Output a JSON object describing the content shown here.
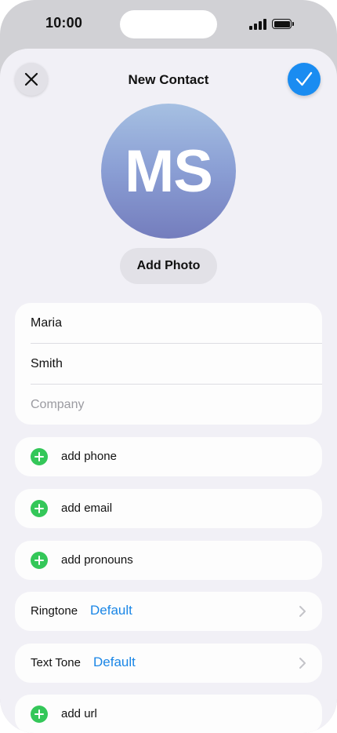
{
  "status": {
    "time": "10:00"
  },
  "nav": {
    "title": "New Contact",
    "cancel_icon": "close-icon",
    "done_icon": "checkmark-icon"
  },
  "avatar": {
    "initials": "MS",
    "gradient": [
      "#a6c0e2",
      "#747dbd"
    ]
  },
  "add_photo_label": "Add Photo",
  "name_fields": {
    "first": "Maria",
    "last": "Smith",
    "company_placeholder": "Company"
  },
  "add_rows": {
    "phone": "add phone",
    "email": "add email",
    "pronouns": "add pronouns",
    "url": "add url"
  },
  "ringtone": {
    "label": "Ringtone",
    "value": "Default"
  },
  "text_tone": {
    "label": "Text Tone",
    "value": "Default"
  },
  "colors": {
    "accent": "#1a86e6",
    "add": "#34c759",
    "background": "#f1f0f6"
  }
}
